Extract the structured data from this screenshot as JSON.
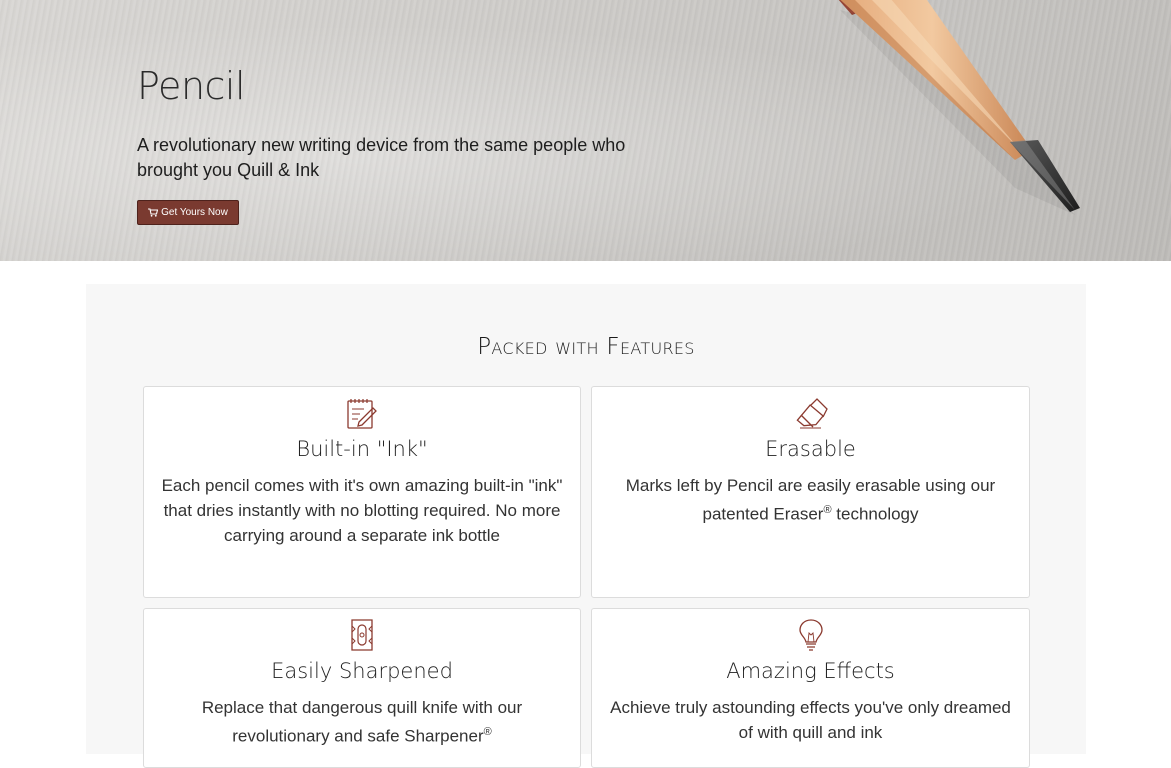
{
  "hero": {
    "title": "Pencil",
    "subtitle": "A revolutionary new writing device from the same people who brought you Quill & Ink",
    "cta_label": "Get Yours Now",
    "cta_icon": "shopping-cart-icon"
  },
  "features": {
    "heading": "Packed with Features",
    "cards": [
      {
        "icon": "notepad-pencil-icon",
        "title": "Built-in \"Ink\"",
        "text": "Each pencil comes with it's own amazing built-in \"ink\" that dries instantly with no blotting required. No more carrying around a separate ink bottle"
      },
      {
        "icon": "eraser-icon",
        "title": "Erasable",
        "text_before": "Marks left by Pencil are easily erasable using our patented Eraser",
        "text_sup": "®",
        "text_after": " technology"
      },
      {
        "icon": "sharpener-icon",
        "title": "Easily Sharpened",
        "text_before": "Replace that dangerous quill knife with our revolutionary and safe Sharpener",
        "text_sup": "®",
        "text_after": ""
      },
      {
        "icon": "lightbulb-icon",
        "title": "Amazing Effects",
        "text": "Achieve truly astounding effects you've only dreamed of with quill and ink"
      }
    ]
  },
  "colors": {
    "accent": "#7a3a30",
    "icon_stroke": "#8b3a2f",
    "panel_bg": "#f7f7f7"
  }
}
